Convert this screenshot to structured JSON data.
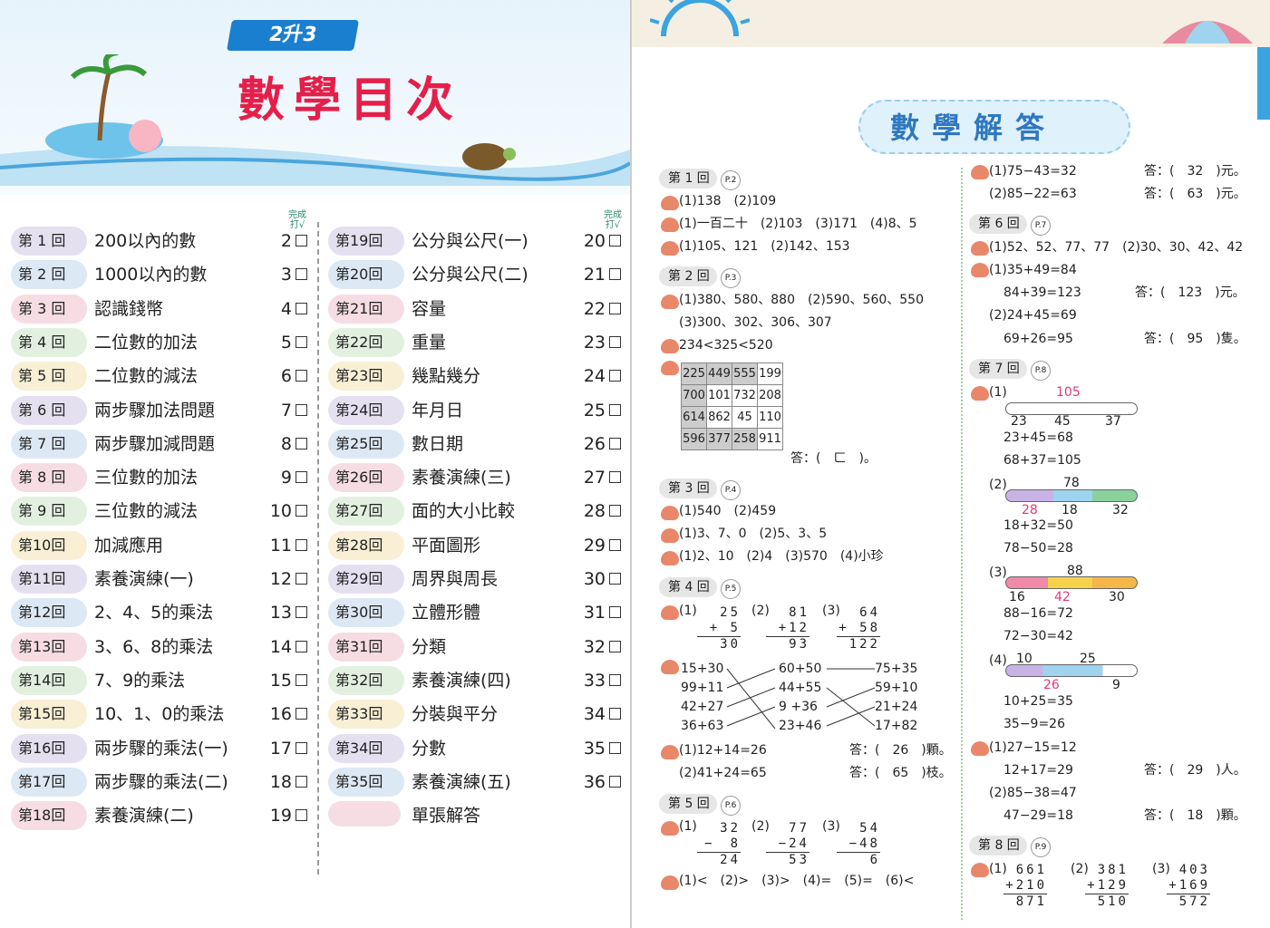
{
  "left": {
    "grade": "2升3",
    "title": "數學目次",
    "done_label": "完成打√",
    "lessons_col1": [
      {
        "tag": "第 1 回",
        "title": "200以內的數",
        "page": "2"
      },
      {
        "tag": "第 2 回",
        "title": "1000以內的數",
        "page": "3"
      },
      {
        "tag": "第 3 回",
        "title": "認識錢幣",
        "page": "4"
      },
      {
        "tag": "第 4 回",
        "title": "二位數的加法",
        "page": "5"
      },
      {
        "tag": "第 5 回",
        "title": "二位數的減法",
        "page": "6"
      },
      {
        "tag": "第 6 回",
        "title": "兩步驟加法問題",
        "page": "7"
      },
      {
        "tag": "第 7 回",
        "title": "兩步驟加減問題",
        "page": "8"
      },
      {
        "tag": "第 8 回",
        "title": "三位數的加法",
        "page": "9"
      },
      {
        "tag": "第 9 回",
        "title": "三位數的減法",
        "page": "10"
      },
      {
        "tag": "第10回",
        "title": "加減應用",
        "page": "11"
      },
      {
        "tag": "第11回",
        "title": "素養演練(一)",
        "page": "12"
      },
      {
        "tag": "第12回",
        "title": "2、4、5的乘法",
        "page": "13"
      },
      {
        "tag": "第13回",
        "title": "3、6、8的乘法",
        "page": "14"
      },
      {
        "tag": "第14回",
        "title": "7、9的乘法",
        "page": "15"
      },
      {
        "tag": "第15回",
        "title": "10、1、0的乘法",
        "page": "16"
      },
      {
        "tag": "第16回",
        "title": "兩步驟的乘法(一)",
        "page": "17"
      },
      {
        "tag": "第17回",
        "title": "兩步驟的乘法(二)",
        "page": "18"
      },
      {
        "tag": "第18回",
        "title": "素養演練(二)",
        "page": "19"
      }
    ],
    "lessons_col2": [
      {
        "tag": "第19回",
        "title": "公分與公尺(一)",
        "page": "20"
      },
      {
        "tag": "第20回",
        "title": "公分與公尺(二)",
        "page": "21"
      },
      {
        "tag": "第21回",
        "title": "容量",
        "page": "22"
      },
      {
        "tag": "第22回",
        "title": "重量",
        "page": "23"
      },
      {
        "tag": "第23回",
        "title": "幾點幾分",
        "page": "24"
      },
      {
        "tag": "第24回",
        "title": "年月日",
        "page": "25"
      },
      {
        "tag": "第25回",
        "title": "數日期",
        "page": "26"
      },
      {
        "tag": "第26回",
        "title": "素養演練(三)",
        "page": "27"
      },
      {
        "tag": "第27回",
        "title": "面的大小比較",
        "page": "28"
      },
      {
        "tag": "第28回",
        "title": "平面圖形",
        "page": "29"
      },
      {
        "tag": "第29回",
        "title": "周界與周長",
        "page": "30"
      },
      {
        "tag": "第30回",
        "title": "立體形體",
        "page": "31"
      },
      {
        "tag": "第31回",
        "title": "分類",
        "page": "32"
      },
      {
        "tag": "第32回",
        "title": "素養演練(四)",
        "page": "33"
      },
      {
        "tag": "第33回",
        "title": "分裝與平分",
        "page": "34"
      },
      {
        "tag": "第34回",
        "title": "分數",
        "page": "35"
      },
      {
        "tag": "第35回",
        "title": "素養演練(五)",
        "page": "36"
      },
      {
        "tag": "",
        "title": "單張解答",
        "page": ""
      }
    ]
  },
  "right": {
    "title": "數學解答",
    "s1": {
      "tag": "第 1 回",
      "pg": "P.2",
      "l1": "(1)138　(2)109",
      "l2": "(1)一百二十　(2)103　(3)171　(4)8、5",
      "l3": "(1)105、121　(2)142、153"
    },
    "s2": {
      "tag": "第 2 回",
      "pg": "P.3",
      "l1": "(1)380、580、880　(2)590、560、550",
      "l2": "(3)300、302、306、307",
      "l3": "234<325<520",
      "grid": [
        [
          "225",
          "449",
          "555",
          "199"
        ],
        [
          "700",
          "101",
          "732",
          "208"
        ],
        [
          "614",
          "862",
          "45",
          "110"
        ],
        [
          "596",
          "377",
          "258",
          "911"
        ]
      ],
      "ans": "答：(　ㄈ　)。"
    },
    "s3": {
      "tag": "第 3 回",
      "pg": "P.4",
      "l1": "(1)540　(2)459",
      "l2": "(1)3、7、0　(2)5、3、5",
      "l3": "(1)2、10　(2)4　(3)570　(4)小珍"
    },
    "s4": {
      "tag": "第 4 回",
      "pg": "P.5",
      "v1": [
        "25",
        "+ 5",
        "30"
      ],
      "v2": [
        "81",
        "+12",
        "93"
      ],
      "v3": [
        "64",
        "+ 58",
        "122"
      ],
      "left": [
        "15+30",
        "99+11",
        "42+27",
        "36+63"
      ],
      "mid": [
        "60+50",
        "44+55",
        "9 +36",
        "23+46"
      ],
      "right": [
        "75+35",
        "59+10",
        "21+24",
        "17+82"
      ],
      "l1": "(1)12+14=26",
      "a1": "答：(　26　)顆。",
      "l2": "(2)41+24=65",
      "a2": "答：(　65　)枝。"
    },
    "s5": {
      "tag": "第 5 回",
      "pg": "P.6",
      "v1": [
        "32",
        "−　8",
        "24"
      ],
      "v2": [
        "77",
        "−24",
        "53"
      ],
      "v3": [
        "54",
        "−48",
        "6"
      ],
      "l1": "(1)<　(2)>　(3)>　(4)=　(5)=　(6)<"
    },
    "c2top": {
      "l1": "(1)75−43=32",
      "a1": "答：(　32　)元。",
      "l2": "(2)85−22=63",
      "a2": "答：(　63　)元。"
    },
    "s6": {
      "tag": "第 6 回",
      "pg": "P.7",
      "l1": "(1)52、52、77、77　(2)30、30、42、42",
      "l2": "(1)35+49=84",
      "l3": "84+39=123",
      "a3": "答：(　123　)元。",
      "l4": "(2)24+45=69",
      "l5": "69+26=95",
      "a5": "答：(　95　)隻。"
    },
    "s7": {
      "tag": "第 7 回",
      "pg": "P.8",
      "b1": {
        "tot": "105",
        "a": "23",
        "b": "45",
        "c": "37"
      },
      "e1": "23+45=68",
      "e2": "68+37=105",
      "b2": {
        "tot": "78",
        "a": "28",
        "b": "18",
        "c": "32"
      },
      "e3": "18+32=50",
      "e4": "78−50=28",
      "b3": {
        "tot": "88",
        "a": "16",
        "b": "42",
        "c": "30"
      },
      "e5": "88−16=72",
      "e6": "72−30=42",
      "b4": {
        "tot": "25",
        "a": "10",
        "b": "26",
        "c": "9"
      },
      "e7": "10+25=35",
      "e8": "35−9=26",
      "l1": "(1)27−15=12",
      "l2": "12+17=29",
      "a2": "答：(　29　)人。",
      "l3": "(2)85−38=47",
      "l4": "47−29=18",
      "a4": "答：(　18　)顆。"
    },
    "s8": {
      "tag": "第 8 回",
      "pg": "P.9",
      "v1": [
        "661",
        "+210",
        "871"
      ],
      "v2": [
        "381",
        "+129",
        "510"
      ],
      "v3": [
        "403",
        "+169",
        "572"
      ]
    }
  }
}
